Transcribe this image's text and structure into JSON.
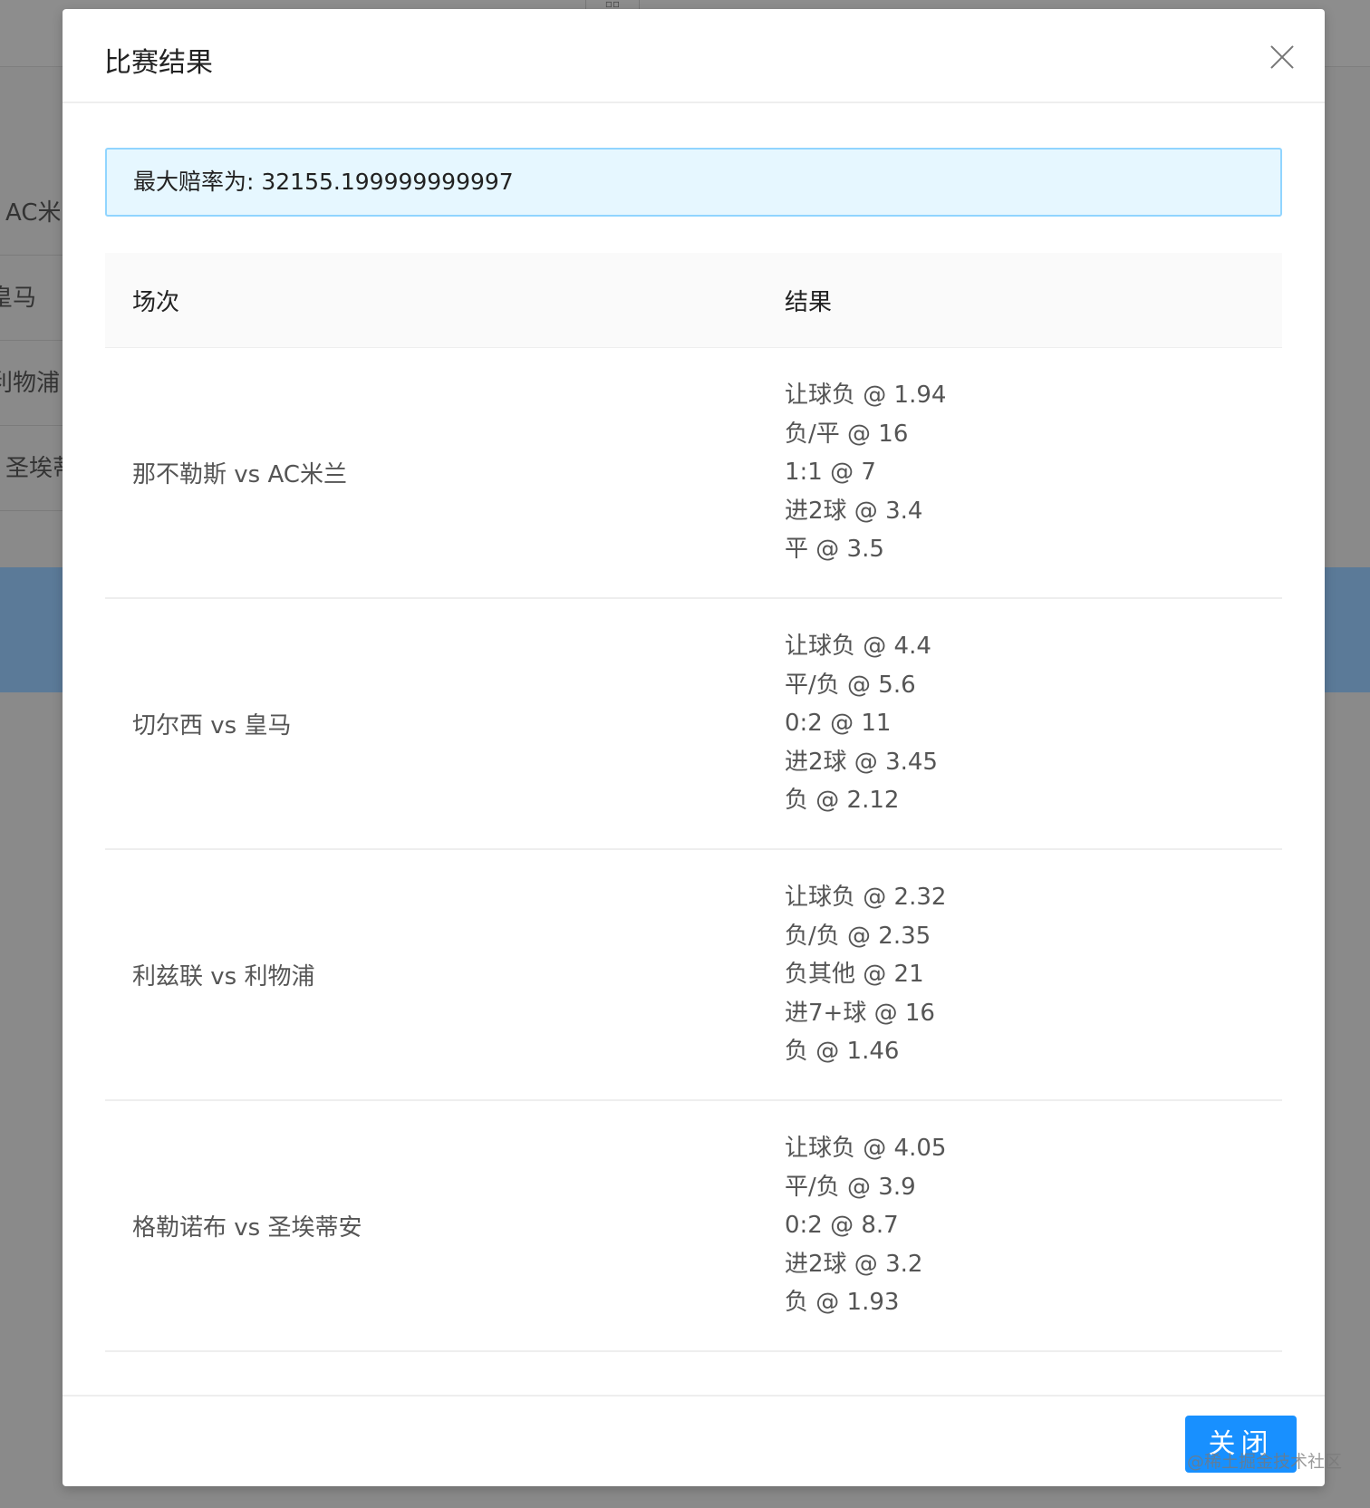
{
  "background": {
    "rows": [
      "AC米",
      "皇马",
      "利物浦",
      "圣埃蒂"
    ]
  },
  "modal": {
    "title": "比赛结果",
    "alert": "最大赔率为: 32155.199999999997",
    "columns": [
      "场次",
      "结果"
    ],
    "rows": [
      {
        "match": "那不勒斯 vs AC米兰",
        "results": [
          "让球负 @ 1.94",
          "负/平 @ 16",
          "1:1 @ 7",
          "进2球 @ 3.4",
          "平 @ 3.5"
        ]
      },
      {
        "match": "切尔西 vs 皇马",
        "results": [
          "让球负 @ 4.4",
          "平/负 @ 5.6",
          "0:2 @ 11",
          "进2球 @ 3.45",
          "负 @ 2.12"
        ]
      },
      {
        "match": "利兹联 vs 利物浦",
        "results": [
          "让球负 @ 2.32",
          "负/负 @ 2.35",
          "负其他 @ 21",
          "进7+球 @ 16",
          "负 @ 1.46"
        ]
      },
      {
        "match": "格勒诺布 vs 圣埃蒂安",
        "results": [
          "让球负 @ 4.05",
          "平/负 @ 3.9",
          "0:2 @ 8.7",
          "进2球 @ 3.2",
          "负 @ 1.93"
        ]
      }
    ],
    "close_button": "关闭"
  },
  "watermark": "@稀土掘金技术社区"
}
